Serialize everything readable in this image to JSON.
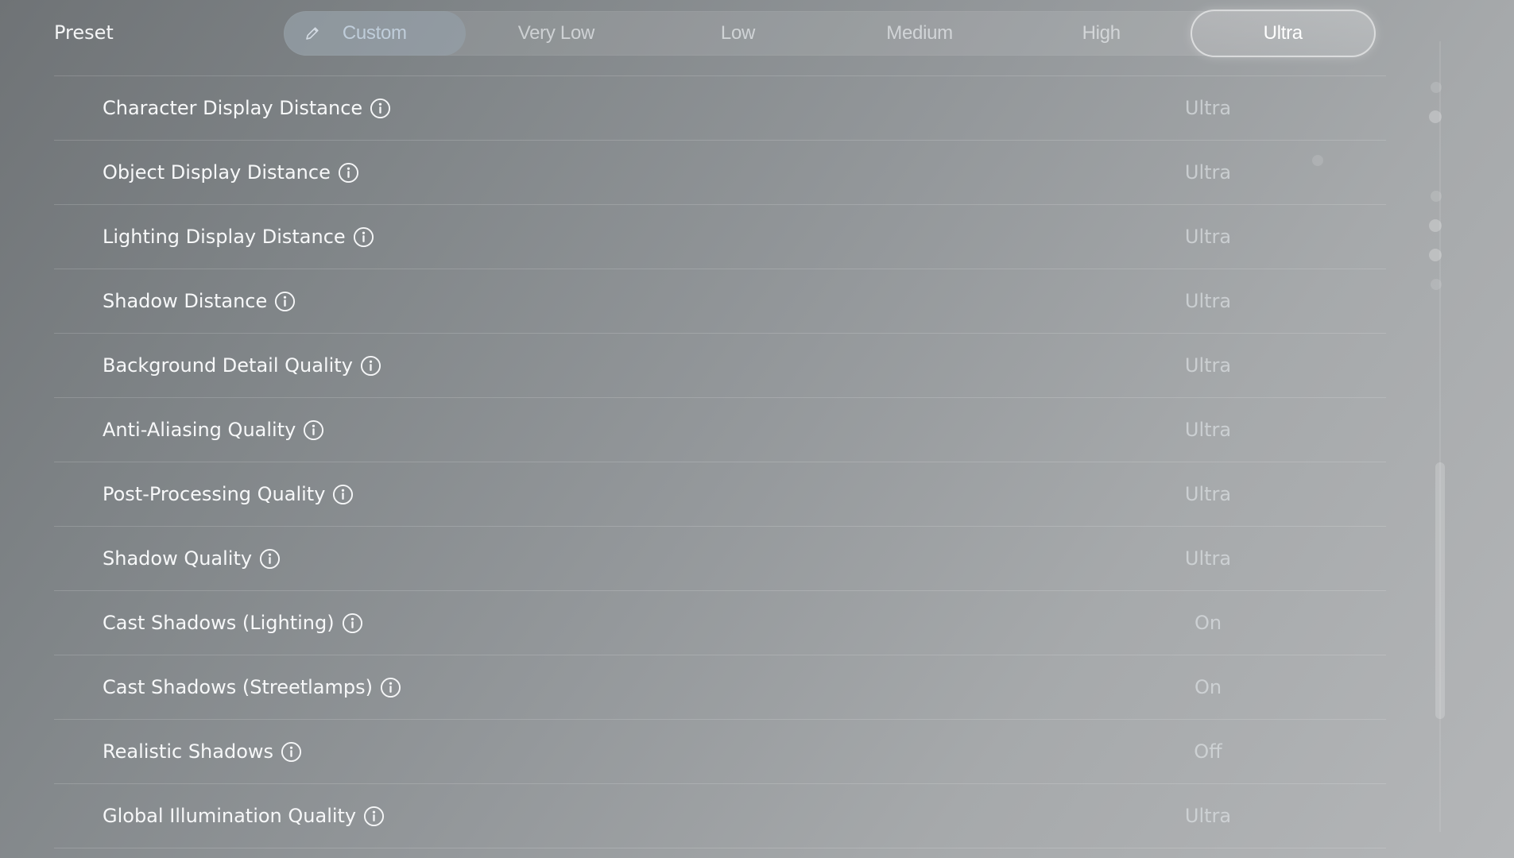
{
  "preset": {
    "label": "Preset",
    "options": [
      {
        "label": "Custom",
        "state": "custom",
        "icon": "pencil-icon"
      },
      {
        "label": "Very Low",
        "state": "normal"
      },
      {
        "label": "Low",
        "state": "normal"
      },
      {
        "label": "Medium",
        "state": "normal"
      },
      {
        "label": "High",
        "state": "normal"
      },
      {
        "label": "Ultra",
        "state": "selected"
      }
    ]
  },
  "settings": [
    {
      "label": "Character Display Distance",
      "value": "Ultra",
      "icon": "info-icon"
    },
    {
      "label": "Object Display Distance",
      "value": "Ultra",
      "icon": "info-icon"
    },
    {
      "label": "Lighting Display Distance",
      "value": "Ultra",
      "icon": "info-icon"
    },
    {
      "label": "Shadow Distance",
      "value": "Ultra",
      "icon": "info-icon"
    },
    {
      "label": "Background Detail Quality",
      "value": "Ultra",
      "icon": "info-icon"
    },
    {
      "label": "Anti-Aliasing Quality",
      "value": "Ultra",
      "icon": "info-icon"
    },
    {
      "label": "Post-Processing Quality",
      "value": "Ultra",
      "icon": "info-icon"
    },
    {
      "label": "Shadow Quality",
      "value": "Ultra",
      "icon": "info-icon"
    },
    {
      "label": "Cast Shadows (Lighting)",
      "value": "On",
      "icon": "info-icon"
    },
    {
      "label": "Cast Shadows (Streetlamps)",
      "value": "On",
      "icon": "info-icon"
    },
    {
      "label": "Realistic Shadows",
      "value": "Off",
      "icon": "info-icon"
    },
    {
      "label": "Global Illumination Quality",
      "value": "Ultra",
      "icon": "info-icon"
    }
  ],
  "colors": {
    "text_primary": "#f7f8f9",
    "text_value": "#dce0e3",
    "background_dark": "#6f7376",
    "background_light": "#b4b6b8",
    "selected_glow": "#ffffff"
  }
}
